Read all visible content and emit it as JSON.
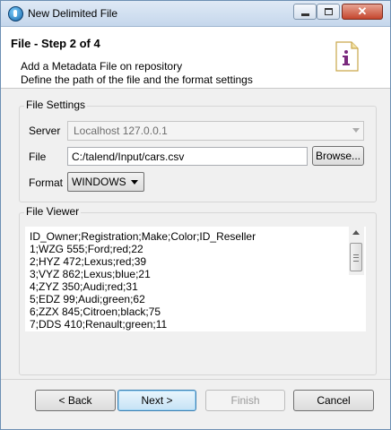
{
  "window": {
    "title": "New Delimited File"
  },
  "header": {
    "step_title": "File - Step 2 of 4",
    "description_line1": "Add a Metadata File on repository",
    "description_line2": "Define the path of the file and the format settings"
  },
  "file_settings": {
    "group_label": "File Settings",
    "server_label": "Server",
    "server_value": "Localhost 127.0.0.1",
    "file_label": "File",
    "file_value": "C:/talend/Input/cars.csv",
    "browse_label": "Browse...",
    "format_label": "Format",
    "format_value": "WINDOWS"
  },
  "file_viewer": {
    "group_label": "File Viewer",
    "lines": [
      "ID_Owner;Registration;Make;Color;ID_Reseller",
      "1;WZG 555;Ford;red;22",
      "2;HYZ 472;Lexus;red;39",
      "3;VYZ 862;Lexus;blue;21",
      "4;ZYZ 350;Audi;red;31",
      "5;EDZ 99;Audi;green;62",
      "6;ZZX 845;Citroen;black;75",
      "7;DDS 410;Renault;green;11"
    ]
  },
  "buttons": {
    "back": "< Back",
    "next": "Next >",
    "finish": "Finish",
    "cancel": "Cancel"
  }
}
